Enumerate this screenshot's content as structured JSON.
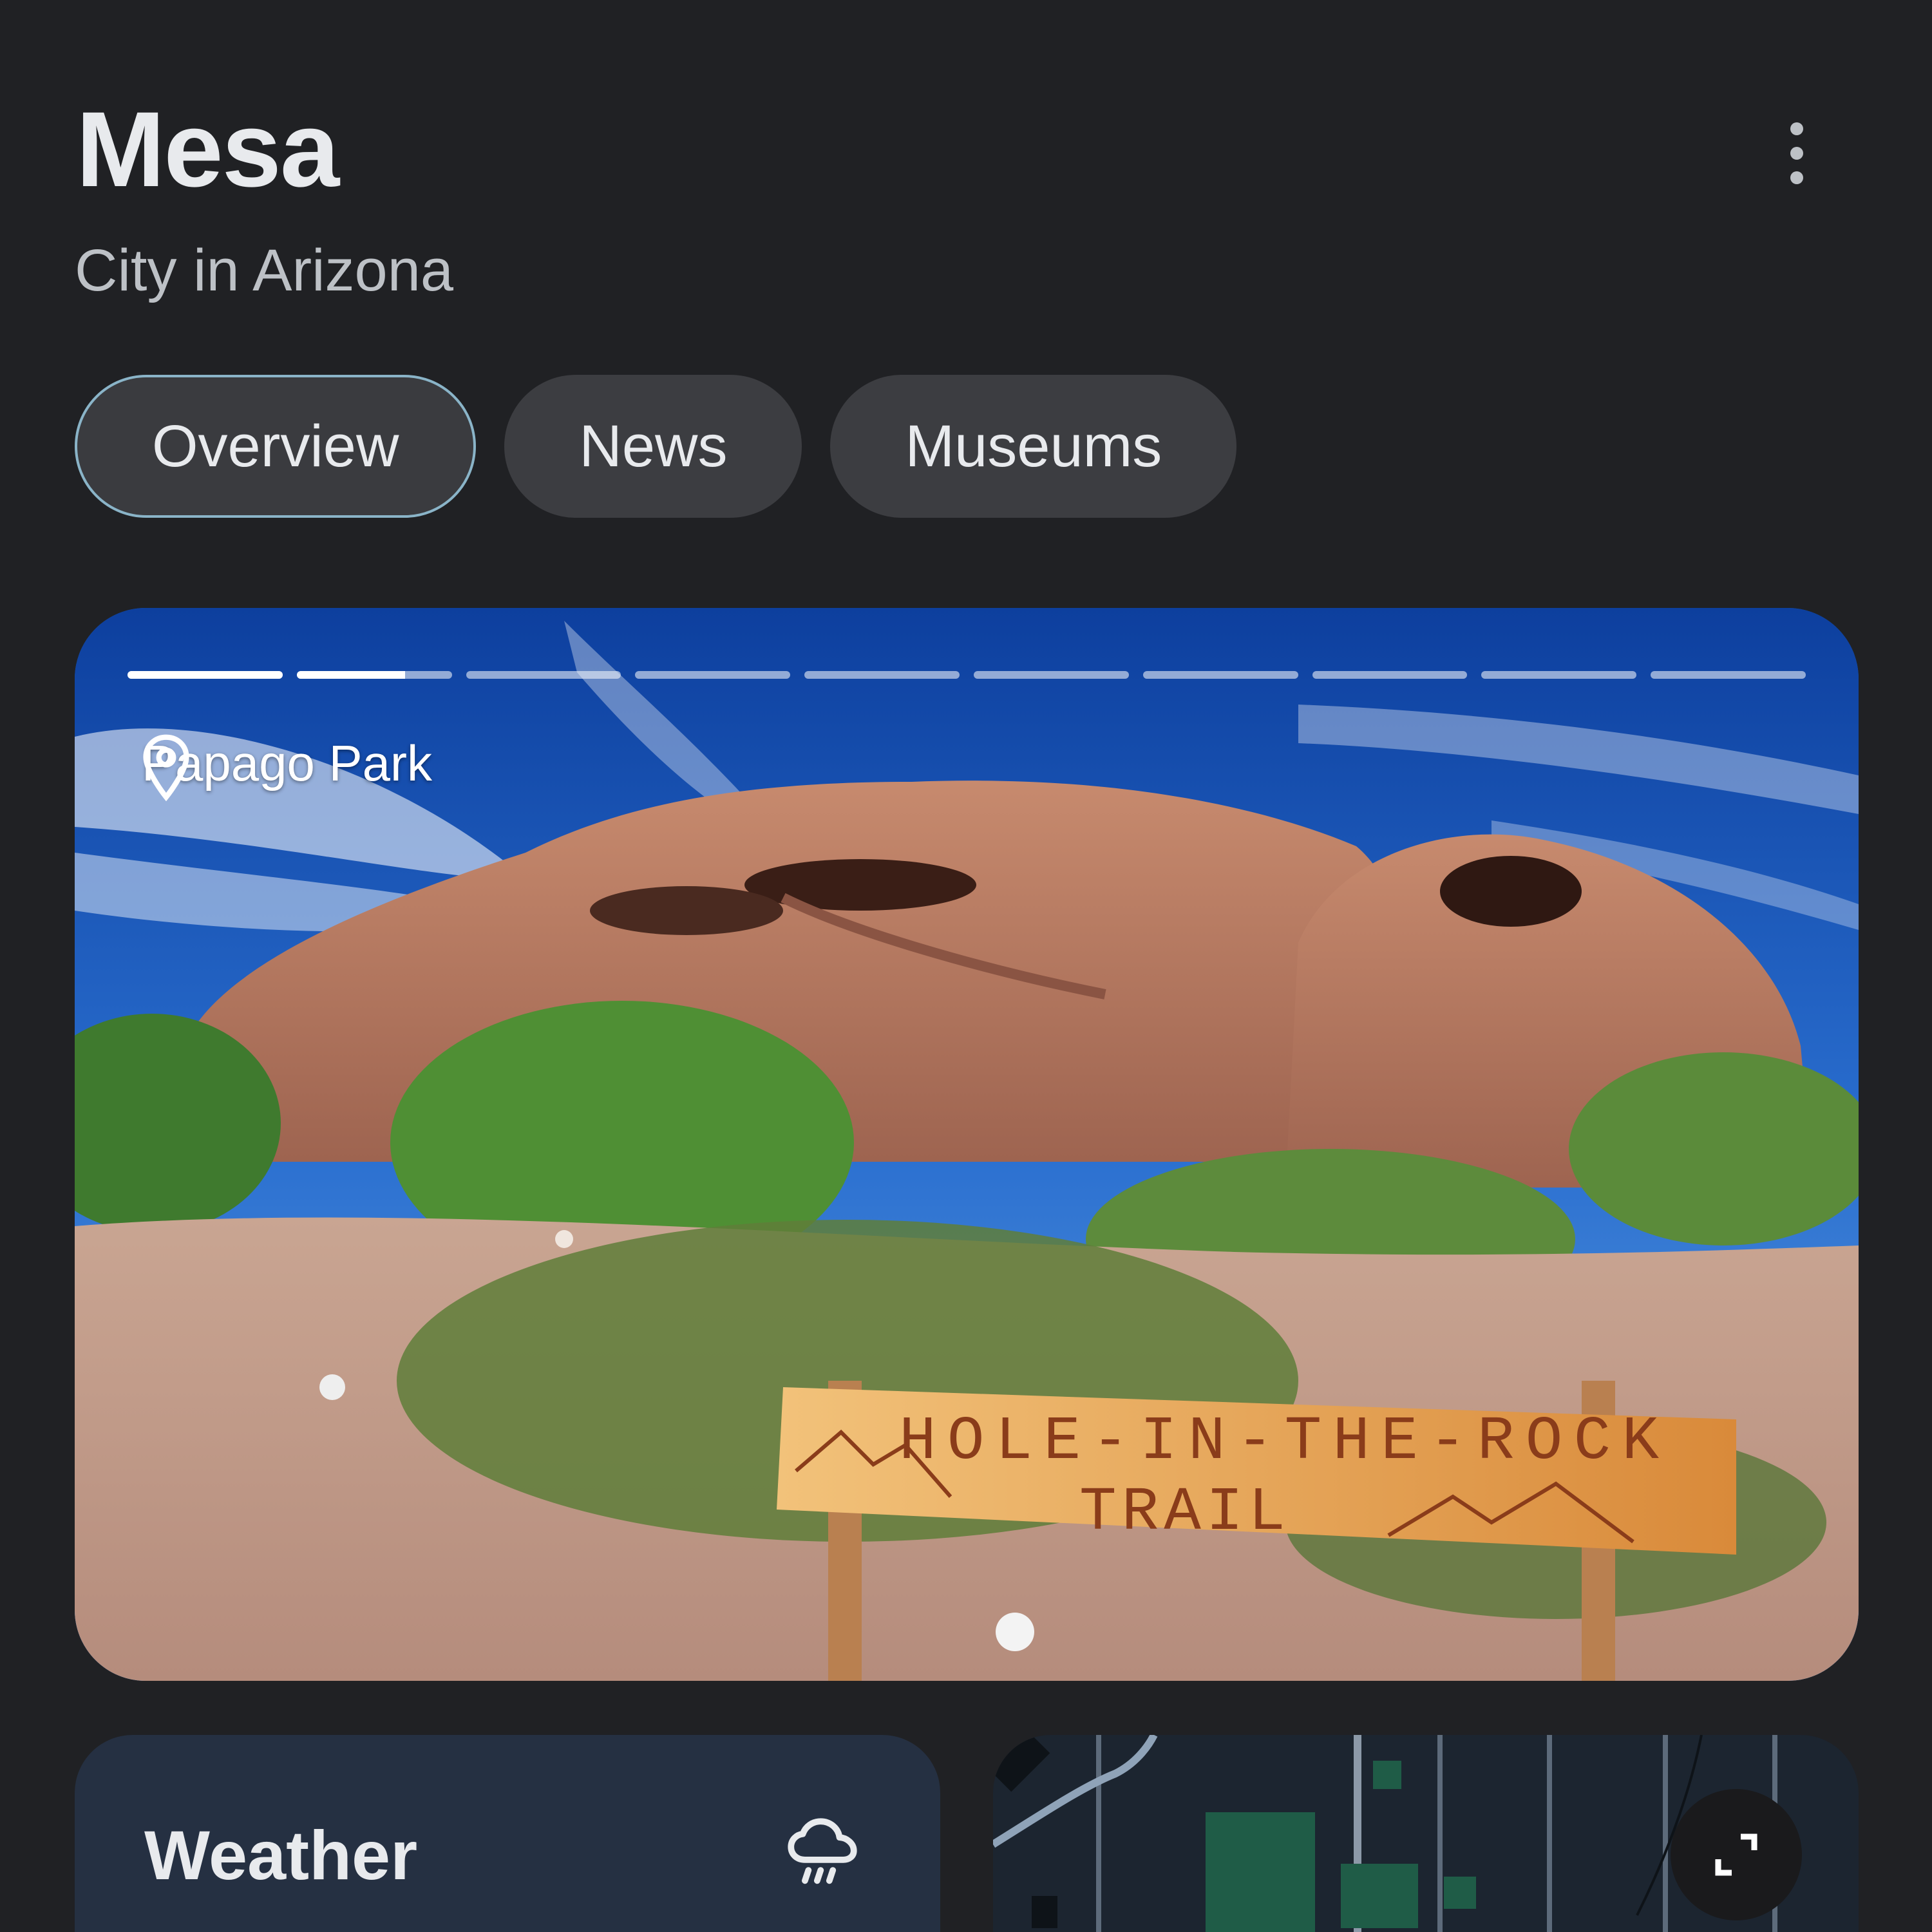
{
  "header": {
    "title": "Mesa",
    "subtitle": "City in Arizona",
    "menu_icon": "more-vert-icon"
  },
  "tabs": [
    {
      "label": "Overview",
      "selected": true
    },
    {
      "label": "News",
      "selected": false
    },
    {
      "label": "Museums",
      "selected": false
    }
  ],
  "hero": {
    "location_label": "Papago Park",
    "location_icon": "map-pin-icon",
    "slide_count": 10,
    "current_slide": 2,
    "current_slide_progress": 0.7,
    "sign_text": "HOLE-IN-THE-ROCK TRAIL"
  },
  "weather": {
    "title": "Weather",
    "icon": "rain-cloud-icon"
  },
  "map": {
    "expand_icon": "expand-icon"
  },
  "colors": {
    "background": "#202124",
    "chip": "#3c3d41",
    "chip_selected_border": "#8ab4c8",
    "weather_card": "#253042",
    "map_card": "#1c2530",
    "text_primary": "#e8eaed",
    "text_secondary": "#bdc1c6"
  }
}
